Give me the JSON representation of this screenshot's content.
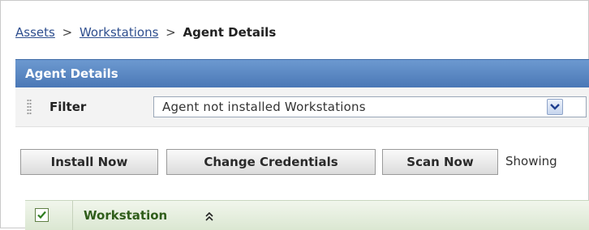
{
  "breadcrumb": {
    "items": [
      {
        "label": "Assets",
        "link": true
      },
      {
        "label": "Workstations",
        "link": true
      },
      {
        "label": "Agent Details",
        "link": false
      }
    ],
    "separator": ">"
  },
  "panel": {
    "title": "Agent Details"
  },
  "filter": {
    "label": "Filter",
    "selected": "Agent not installed Workstations"
  },
  "actions": {
    "install_now": "Install Now",
    "change_credentials": "Change Credentials",
    "scan_now": "Scan Now",
    "showing": "Showing"
  },
  "table": {
    "columns": [
      {
        "label": "Workstation",
        "sortable": true
      }
    ],
    "select_all_checked": true
  },
  "colors": {
    "header_blue": "#4a78b6",
    "table_header_green": "#dbe7d2",
    "link_blue": "#2f4f8f"
  }
}
